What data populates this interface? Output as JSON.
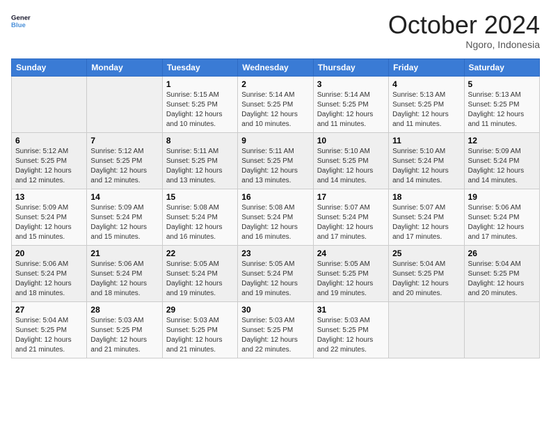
{
  "logo": {
    "line1": "General",
    "line2": "Blue"
  },
  "title": "October 2024",
  "location": "Ngoro, Indonesia",
  "days_header": [
    "Sunday",
    "Monday",
    "Tuesday",
    "Wednesday",
    "Thursday",
    "Friday",
    "Saturday"
  ],
  "weeks": [
    [
      {
        "day": "",
        "sunrise": "",
        "sunset": "",
        "daylight": ""
      },
      {
        "day": "",
        "sunrise": "",
        "sunset": "",
        "daylight": ""
      },
      {
        "day": "1",
        "sunrise": "Sunrise: 5:15 AM",
        "sunset": "Sunset: 5:25 PM",
        "daylight": "Daylight: 12 hours and 10 minutes."
      },
      {
        "day": "2",
        "sunrise": "Sunrise: 5:14 AM",
        "sunset": "Sunset: 5:25 PM",
        "daylight": "Daylight: 12 hours and 10 minutes."
      },
      {
        "day": "3",
        "sunrise": "Sunrise: 5:14 AM",
        "sunset": "Sunset: 5:25 PM",
        "daylight": "Daylight: 12 hours and 11 minutes."
      },
      {
        "day": "4",
        "sunrise": "Sunrise: 5:13 AM",
        "sunset": "Sunset: 5:25 PM",
        "daylight": "Daylight: 12 hours and 11 minutes."
      },
      {
        "day": "5",
        "sunrise": "Sunrise: 5:13 AM",
        "sunset": "Sunset: 5:25 PM",
        "daylight": "Daylight: 12 hours and 11 minutes."
      }
    ],
    [
      {
        "day": "6",
        "sunrise": "Sunrise: 5:12 AM",
        "sunset": "Sunset: 5:25 PM",
        "daylight": "Daylight: 12 hours and 12 minutes."
      },
      {
        "day": "7",
        "sunrise": "Sunrise: 5:12 AM",
        "sunset": "Sunset: 5:25 PM",
        "daylight": "Daylight: 12 hours and 12 minutes."
      },
      {
        "day": "8",
        "sunrise": "Sunrise: 5:11 AM",
        "sunset": "Sunset: 5:25 PM",
        "daylight": "Daylight: 12 hours and 13 minutes."
      },
      {
        "day": "9",
        "sunrise": "Sunrise: 5:11 AM",
        "sunset": "Sunset: 5:25 PM",
        "daylight": "Daylight: 12 hours and 13 minutes."
      },
      {
        "day": "10",
        "sunrise": "Sunrise: 5:10 AM",
        "sunset": "Sunset: 5:25 PM",
        "daylight": "Daylight: 12 hours and 14 minutes."
      },
      {
        "day": "11",
        "sunrise": "Sunrise: 5:10 AM",
        "sunset": "Sunset: 5:24 PM",
        "daylight": "Daylight: 12 hours and 14 minutes."
      },
      {
        "day": "12",
        "sunrise": "Sunrise: 5:09 AM",
        "sunset": "Sunset: 5:24 PM",
        "daylight": "Daylight: 12 hours and 14 minutes."
      }
    ],
    [
      {
        "day": "13",
        "sunrise": "Sunrise: 5:09 AM",
        "sunset": "Sunset: 5:24 PM",
        "daylight": "Daylight: 12 hours and 15 minutes."
      },
      {
        "day": "14",
        "sunrise": "Sunrise: 5:09 AM",
        "sunset": "Sunset: 5:24 PM",
        "daylight": "Daylight: 12 hours and 15 minutes."
      },
      {
        "day": "15",
        "sunrise": "Sunrise: 5:08 AM",
        "sunset": "Sunset: 5:24 PM",
        "daylight": "Daylight: 12 hours and 16 minutes."
      },
      {
        "day": "16",
        "sunrise": "Sunrise: 5:08 AM",
        "sunset": "Sunset: 5:24 PM",
        "daylight": "Daylight: 12 hours and 16 minutes."
      },
      {
        "day": "17",
        "sunrise": "Sunrise: 5:07 AM",
        "sunset": "Sunset: 5:24 PM",
        "daylight": "Daylight: 12 hours and 17 minutes."
      },
      {
        "day": "18",
        "sunrise": "Sunrise: 5:07 AM",
        "sunset": "Sunset: 5:24 PM",
        "daylight": "Daylight: 12 hours and 17 minutes."
      },
      {
        "day": "19",
        "sunrise": "Sunrise: 5:06 AM",
        "sunset": "Sunset: 5:24 PM",
        "daylight": "Daylight: 12 hours and 17 minutes."
      }
    ],
    [
      {
        "day": "20",
        "sunrise": "Sunrise: 5:06 AM",
        "sunset": "Sunset: 5:24 PM",
        "daylight": "Daylight: 12 hours and 18 minutes."
      },
      {
        "day": "21",
        "sunrise": "Sunrise: 5:06 AM",
        "sunset": "Sunset: 5:24 PM",
        "daylight": "Daylight: 12 hours and 18 minutes."
      },
      {
        "day": "22",
        "sunrise": "Sunrise: 5:05 AM",
        "sunset": "Sunset: 5:24 PM",
        "daylight": "Daylight: 12 hours and 19 minutes."
      },
      {
        "day": "23",
        "sunrise": "Sunrise: 5:05 AM",
        "sunset": "Sunset: 5:24 PM",
        "daylight": "Daylight: 12 hours and 19 minutes."
      },
      {
        "day": "24",
        "sunrise": "Sunrise: 5:05 AM",
        "sunset": "Sunset: 5:25 PM",
        "daylight": "Daylight: 12 hours and 19 minutes."
      },
      {
        "day": "25",
        "sunrise": "Sunrise: 5:04 AM",
        "sunset": "Sunset: 5:25 PM",
        "daylight": "Daylight: 12 hours and 20 minutes."
      },
      {
        "day": "26",
        "sunrise": "Sunrise: 5:04 AM",
        "sunset": "Sunset: 5:25 PM",
        "daylight": "Daylight: 12 hours and 20 minutes."
      }
    ],
    [
      {
        "day": "27",
        "sunrise": "Sunrise: 5:04 AM",
        "sunset": "Sunset: 5:25 PM",
        "daylight": "Daylight: 12 hours and 21 minutes."
      },
      {
        "day": "28",
        "sunrise": "Sunrise: 5:03 AM",
        "sunset": "Sunset: 5:25 PM",
        "daylight": "Daylight: 12 hours and 21 minutes."
      },
      {
        "day": "29",
        "sunrise": "Sunrise: 5:03 AM",
        "sunset": "Sunset: 5:25 PM",
        "daylight": "Daylight: 12 hours and 21 minutes."
      },
      {
        "day": "30",
        "sunrise": "Sunrise: 5:03 AM",
        "sunset": "Sunset: 5:25 PM",
        "daylight": "Daylight: 12 hours and 22 minutes."
      },
      {
        "day": "31",
        "sunrise": "Sunrise: 5:03 AM",
        "sunset": "Sunset: 5:25 PM",
        "daylight": "Daylight: 12 hours and 22 minutes."
      },
      {
        "day": "",
        "sunrise": "",
        "sunset": "",
        "daylight": ""
      },
      {
        "day": "",
        "sunrise": "",
        "sunset": "",
        "daylight": ""
      }
    ]
  ]
}
